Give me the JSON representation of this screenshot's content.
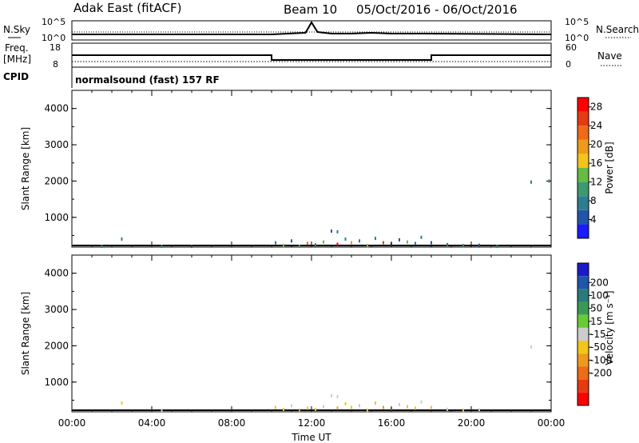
{
  "header": {
    "station": "Adak East (fitACF)",
    "beam": "Beam 10",
    "date_range": "05/Oct/2016 - 06/Oct/2016"
  },
  "colors": {
    "power": [
      "#1a1aff",
      "#2255aa",
      "#2e7d8f",
      "#3b9a6e",
      "#66bb44",
      "#f3c419",
      "#f09a1c",
      "#ee6b17",
      "#e63a14",
      "#ff0000"
    ],
    "velocity": [
      "#1a1acc",
      "#1f55aa",
      "#2a7a7a",
      "#3a9a55",
      "#66cc33",
      "#cccccc",
      "#f3c419",
      "#f09a1c",
      "#ee6b17",
      "#e63a14",
      "#ff0000"
    ]
  },
  "chart_data": [
    {
      "type": "line",
      "name": "noise",
      "left_label": "N.Sky",
      "right_label": "N.Search",
      "left_ticks": [
        "10^5",
        "10^0"
      ],
      "right_ticks": [
        "10^5",
        "10^0"
      ],
      "x": [
        0,
        10,
        11.7,
        12.0,
        12.3,
        13,
        14,
        15,
        16,
        17.5,
        24
      ],
      "values": [
        0.25,
        0.25,
        0.35,
        1.0,
        0.4,
        0.3,
        0.3,
        0.35,
        0.3,
        0.3,
        0.25
      ]
    },
    {
      "type": "line",
      "name": "freq_nave",
      "left_label": "Freq.",
      "left_unit": "[MHz]",
      "left_ticks": [
        "18",
        "8"
      ],
      "right_label": "Nave",
      "right_ticks": [
        "60",
        "0"
      ],
      "freq": {
        "x": [
          0,
          10,
          10,
          18,
          18,
          24
        ],
        "values": [
          13,
          13,
          10.5,
          10.5,
          13,
          13
        ]
      },
      "nave": {
        "x": [
          0,
          24
        ],
        "values": [
          10,
          10
        ]
      }
    },
    {
      "type": "table",
      "name": "cpid",
      "label": "CPID",
      "value": "normalsound (fast) 157 RF"
    },
    {
      "type": "heatmap",
      "name": "power",
      "ylabel": "Slant Range [km]",
      "yticks": [
        "1000",
        "2000",
        "3000",
        "4000"
      ],
      "ylim": [
        180,
        4500
      ],
      "xlim": [
        0,
        24
      ],
      "colorbar_label": "Power [dB]",
      "colorbar_ticks": [
        "4",
        "8",
        "12",
        "16",
        "20",
        "24",
        "28"
      ],
      "colorbar_range": [
        0,
        30
      ],
      "points": [
        [
          2.5,
          400,
          8
        ],
        [
          1.5,
          200,
          6
        ],
        [
          4.5,
          200,
          8
        ],
        [
          6,
          200,
          6
        ],
        [
          10.2,
          300,
          8
        ],
        [
          10.6,
          220,
          12
        ],
        [
          11,
          350,
          4
        ],
        [
          11.4,
          200,
          10
        ],
        [
          11.8,
          280,
          22
        ],
        [
          12.2,
          240,
          8
        ],
        [
          12.6,
          320,
          12
        ],
        [
          13,
          620,
          4
        ],
        [
          13.3,
          600,
          8
        ],
        [
          13.3,
          260,
          28
        ],
        [
          13.7,
          400,
          6
        ],
        [
          14,
          300,
          20
        ],
        [
          14.4,
          350,
          8
        ],
        [
          14.8,
          220,
          12
        ],
        [
          15.2,
          420,
          6
        ],
        [
          15.6,
          300,
          24
        ],
        [
          16,
          260,
          8
        ],
        [
          16.4,
          380,
          4
        ],
        [
          16.8,
          320,
          12
        ],
        [
          17.2,
          280,
          8
        ],
        [
          17.5,
          450,
          6
        ],
        [
          18,
          300,
          4
        ],
        [
          18.8,
          250,
          8
        ],
        [
          19.6,
          220,
          6
        ],
        [
          20.4,
          230,
          4
        ],
        [
          21.3,
          200,
          8
        ],
        [
          23,
          1970,
          8
        ],
        [
          23.9,
          2000,
          6
        ]
      ]
    },
    {
      "type": "heatmap",
      "name": "velocity",
      "ylabel": "Slant Range [km]",
      "yticks": [
        "1000",
        "2000",
        "3000",
        "4000"
      ],
      "ylim": [
        180,
        4500
      ],
      "xlim": [
        0,
        24
      ],
      "xticks": [
        "00:00",
        "04:00",
        "08:00",
        "12:00",
        "16:00",
        "20:00",
        "00:00"
      ],
      "xlabel": "Time UT",
      "colorbar_label": "Velocity [m s⁻¹]",
      "colorbar_ticks": [
        "200",
        "100",
        "50",
        "15",
        "-15",
        "-50",
        "-100",
        "-200"
      ],
      "points": [
        [
          2.5,
          420,
          -20
        ],
        [
          4.5,
          220,
          -15
        ],
        [
          10.2,
          300,
          -20
        ],
        [
          10.6,
          240,
          -30
        ],
        [
          11,
          350,
          -15
        ],
        [
          11.4,
          220,
          -60
        ],
        [
          11.8,
          280,
          -20
        ],
        [
          12.2,
          240,
          -30
        ],
        [
          12.6,
          320,
          -15
        ],
        [
          13,
          620,
          10
        ],
        [
          13.3,
          600,
          10
        ],
        [
          13.3,
          280,
          -80
        ],
        [
          13.7,
          400,
          -20
        ],
        [
          14,
          300,
          -40
        ],
        [
          14.4,
          350,
          -15
        ],
        [
          14.8,
          220,
          -30
        ],
        [
          15.2,
          420,
          -20
        ],
        [
          15.6,
          300,
          -60
        ],
        [
          16,
          260,
          -20
        ],
        [
          16.4,
          380,
          -15
        ],
        [
          16.8,
          320,
          -30
        ],
        [
          17.2,
          280,
          -20
        ],
        [
          17.5,
          450,
          -15
        ],
        [
          18,
          300,
          -20
        ],
        [
          18.8,
          250,
          -15
        ],
        [
          19.6,
          220,
          -20
        ],
        [
          20.4,
          230,
          -15
        ],
        [
          23,
          1970,
          0
        ]
      ]
    }
  ]
}
